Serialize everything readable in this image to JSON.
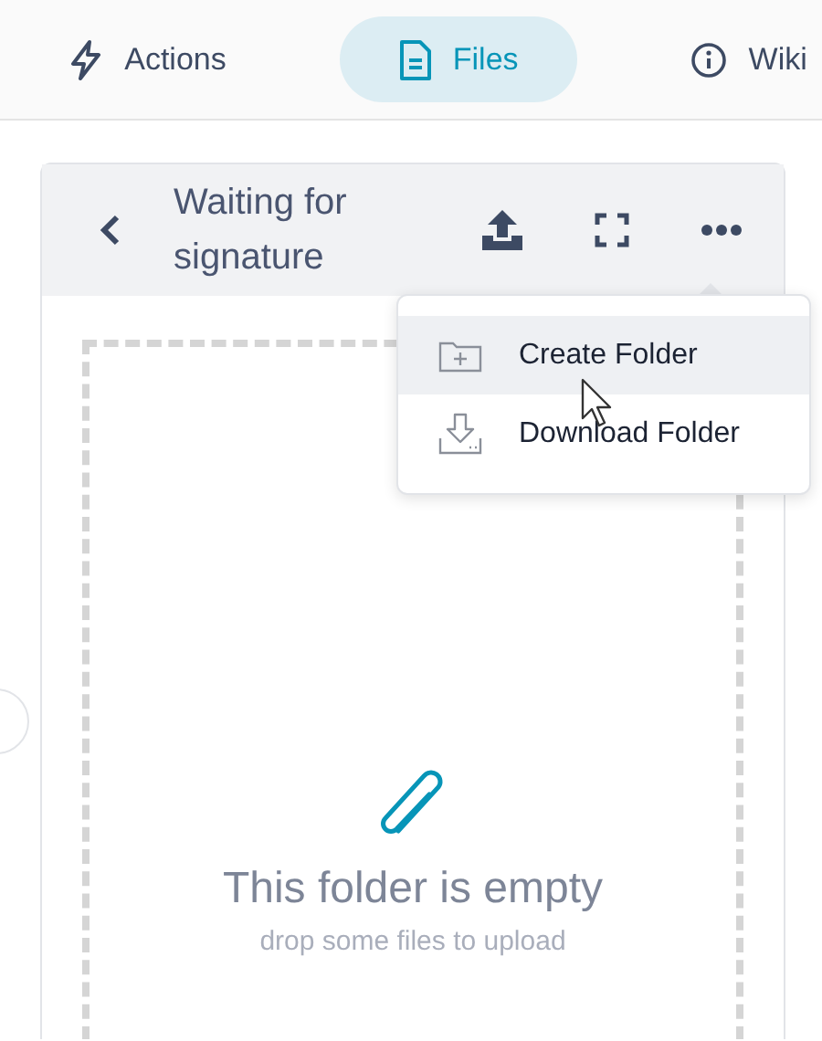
{
  "tabs": [
    {
      "kind": "bolt",
      "label": "Actions",
      "selected": false
    },
    {
      "kind": "document",
      "label": "Files",
      "selected": true
    },
    {
      "kind": "info",
      "label": "Wiki",
      "selected": false
    }
  ],
  "panel": {
    "title": "Waiting for signature",
    "menu": [
      {
        "kind": "folder-plus",
        "label": "Create Folder",
        "selected": true
      },
      {
        "kind": "download",
        "label": "Download Folder",
        "selected": false
      }
    ],
    "empty": {
      "title": "This folder is empty",
      "subtitle": "drop some files to upload"
    }
  }
}
